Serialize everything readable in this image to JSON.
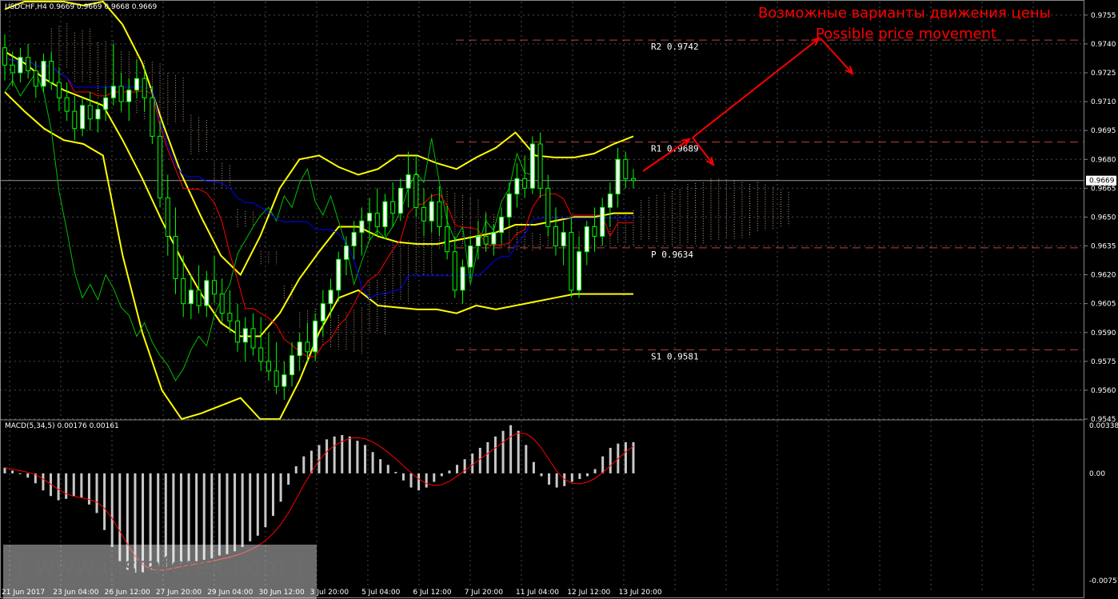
{
  "header": {
    "symbol_line": "USDCHF,H4  0.9669 0.9669 0.9668 0.9669",
    "annotation_ru": "Возможные варианты движения цены",
    "annotation_en": "Possible price movement"
  },
  "colors": {
    "background": "#000000",
    "grid": "#4a4a4a",
    "candle": "#ffffff",
    "candle_body": "#00ff00",
    "bollinger": "#ffff00",
    "kijun": "#0000ff",
    "tenkan": "#ff0000",
    "chikou": "#00c000",
    "cloud": "#c8a080",
    "pivot_lines": "#c04040",
    "arrows": "#ff0000",
    "macd_hist": "#c8c8c8",
    "macd_signal": "#ff0000",
    "watermark": "#6e6e6e"
  },
  "watermark": "[ www.instaforex.com ]",
  "chart_data": {
    "type": "candlestick",
    "ylim": [
      0.9545,
      0.9762
    ],
    "current_price": "0.9669",
    "price_ticks": [
      "0.9755",
      "0.9740",
      "0.9725",
      "0.9710",
      "0.9695",
      "0.9680",
      "0.9665",
      "0.9650",
      "0.9635",
      "0.9620",
      "0.9605",
      "0.9590",
      "0.9575",
      "0.9560",
      "0.9545"
    ],
    "date_labels": [
      "21 Jun 2017",
      "23 Jun 04:00",
      "26 Jun 12:00",
      "27 Jun 20:00",
      "29 Jun 04:00",
      "30 Jun 12:00",
      "3 Jul 20:00",
      "5 Jul 04:00",
      "6 Jul 12:00",
      "7 Jul 20:00",
      "11 Jul 04:00",
      "12 Jul 12:00",
      "13 Jul 20:00"
    ],
    "pivots": [
      {
        "label": "R2",
        "value": "0.9742"
      },
      {
        "label": "R1",
        "value": "0.9689"
      },
      {
        "label": "P",
        "value": "0.9634"
      },
      {
        "label": "S1",
        "value": "0.9581"
      }
    ],
    "candles": [
      [
        0.9738,
        0.9745,
        0.9721,
        0.9729
      ],
      [
        0.9729,
        0.9736,
        0.9718,
        0.9725
      ],
      [
        0.9725,
        0.9738,
        0.972,
        0.9733
      ],
      [
        0.9733,
        0.974,
        0.9722,
        0.9726
      ],
      [
        0.9726,
        0.9731,
        0.9712,
        0.9718
      ],
      [
        0.9718,
        0.9735,
        0.9715,
        0.9731
      ],
      [
        0.9731,
        0.9736,
        0.9716,
        0.972
      ],
      [
        0.972,
        0.9728,
        0.9705,
        0.9712
      ],
      [
        0.9712,
        0.972,
        0.97,
        0.9705
      ],
      [
        0.9705,
        0.9713,
        0.969,
        0.9696
      ],
      [
        0.9696,
        0.9712,
        0.9692,
        0.9708
      ],
      [
        0.9708,
        0.9715,
        0.9695,
        0.9701
      ],
      [
        0.9701,
        0.971,
        0.9694,
        0.9706
      ],
      [
        0.9706,
        0.9718,
        0.97,
        0.9712
      ],
      [
        0.9712,
        0.974,
        0.9708,
        0.9718
      ],
      [
        0.9718,
        0.9725,
        0.9705,
        0.971
      ],
      [
        0.971,
        0.9722,
        0.97,
        0.9716
      ],
      [
        0.9716,
        0.9732,
        0.9712,
        0.9722
      ],
      [
        0.9722,
        0.9728,
        0.9705,
        0.9712
      ],
      [
        0.9712,
        0.9718,
        0.9688,
        0.9692
      ],
      [
        0.9692,
        0.97,
        0.9655,
        0.966
      ],
      [
        0.966,
        0.9672,
        0.963,
        0.964
      ],
      [
        0.964,
        0.9655,
        0.961,
        0.9618
      ],
      [
        0.9618,
        0.963,
        0.9598,
        0.9605
      ],
      [
        0.9605,
        0.962,
        0.9597,
        0.9612
      ],
      [
        0.9612,
        0.9625,
        0.96,
        0.9604
      ],
      [
        0.9604,
        0.9622,
        0.9598,
        0.9617
      ],
      [
        0.9617,
        0.963,
        0.9605,
        0.961
      ],
      [
        0.961,
        0.9618,
        0.9595,
        0.96
      ],
      [
        0.96,
        0.9612,
        0.959,
        0.9596
      ],
      [
        0.9596,
        0.9605,
        0.958,
        0.9585
      ],
      [
        0.9585,
        0.9598,
        0.9575,
        0.9592
      ],
      [
        0.9592,
        0.96,
        0.9578,
        0.9582
      ],
      [
        0.9582,
        0.9598,
        0.957,
        0.9575
      ],
      [
        0.9575,
        0.959,
        0.9565,
        0.957
      ],
      [
        0.957,
        0.9585,
        0.9558,
        0.9562
      ],
      [
        0.9562,
        0.9575,
        0.9555,
        0.9568
      ],
      [
        0.9568,
        0.9585,
        0.9562,
        0.9578
      ],
      [
        0.9578,
        0.959,
        0.957,
        0.9585
      ],
      [
        0.9585,
        0.9595,
        0.9575,
        0.958
      ],
      [
        0.958,
        0.96,
        0.9575,
        0.9596
      ],
      [
        0.9596,
        0.9612,
        0.9588,
        0.9605
      ],
      [
        0.9605,
        0.9618,
        0.9598,
        0.9612
      ],
      [
        0.9612,
        0.9632,
        0.9606,
        0.9628
      ],
      [
        0.9628,
        0.964,
        0.962,
        0.9635
      ],
      [
        0.9635,
        0.9648,
        0.9628,
        0.9642
      ],
      [
        0.9642,
        0.9655,
        0.963,
        0.9648
      ],
      [
        0.9648,
        0.966,
        0.9638,
        0.9652
      ],
      [
        0.9652,
        0.9665,
        0.964,
        0.9645
      ],
      [
        0.9645,
        0.9662,
        0.964,
        0.9658
      ],
      [
        0.9658,
        0.9668,
        0.9645,
        0.9652
      ],
      [
        0.9652,
        0.967,
        0.9648,
        0.9665
      ],
      [
        0.9665,
        0.9684,
        0.9655,
        0.9672
      ],
      [
        0.9672,
        0.9682,
        0.965,
        0.9655
      ],
      [
        0.9655,
        0.9665,
        0.964,
        0.9648
      ],
      [
        0.9648,
        0.9662,
        0.9642,
        0.9658
      ],
      [
        0.9658,
        0.9666,
        0.964,
        0.9645
      ],
      [
        0.9645,
        0.9656,
        0.9628,
        0.9632
      ],
      [
        0.9632,
        0.964,
        0.9608,
        0.9612
      ],
      [
        0.9612,
        0.9628,
        0.9605,
        0.9624
      ],
      [
        0.9624,
        0.964,
        0.9618,
        0.9635
      ],
      [
        0.9635,
        0.9648,
        0.9628,
        0.964
      ],
      [
        0.964,
        0.9652,
        0.9632,
        0.9636
      ],
      [
        0.9636,
        0.9646,
        0.963,
        0.9642
      ],
      [
        0.9642,
        0.9655,
        0.9636,
        0.965
      ],
      [
        0.965,
        0.9668,
        0.9645,
        0.9662
      ],
      [
        0.9662,
        0.9678,
        0.9655,
        0.967
      ],
      [
        0.967,
        0.9682,
        0.966,
        0.9665
      ],
      [
        0.9665,
        0.9692,
        0.9662,
        0.9688
      ],
      [
        0.9688,
        0.9694,
        0.966,
        0.9665
      ],
      [
        0.9665,
        0.9672,
        0.964,
        0.9645
      ],
      [
        0.9645,
        0.9655,
        0.963,
        0.9635
      ],
      [
        0.9635,
        0.9648,
        0.9625,
        0.9642
      ],
      [
        0.9642,
        0.965,
        0.9608,
        0.9612
      ],
      [
        0.9612,
        0.964,
        0.9608,
        0.9632
      ],
      [
        0.9632,
        0.9648,
        0.9625,
        0.9645
      ],
      [
        0.9645,
        0.9655,
        0.9632,
        0.964
      ],
      [
        0.964,
        0.966,
        0.9635,
        0.9655
      ],
      [
        0.9655,
        0.9668,
        0.9645,
        0.9662
      ],
      [
        0.9662,
        0.9686,
        0.9655,
        0.968
      ],
      [
        0.968,
        0.9684,
        0.9665,
        0.967
      ],
      [
        0.967,
        0.9675,
        0.9665,
        0.9669
      ]
    ],
    "bollinger_upper": [
      0.9758,
      0.9766,
      0.9772,
      0.977,
      0.976,
      0.9762,
      0.975,
      0.973,
      0.97,
      0.9672,
      0.965,
      0.963,
      0.962,
      0.964,
      0.9665,
      0.968,
      0.9682,
      0.9676,
      0.9672,
      0.9675,
      0.9682,
      0.9682,
      0.9678,
      0.9675,
      0.9681,
      0.9686,
      0.9694,
      0.9682,
      0.9681,
      0.9681,
      0.9683,
      0.9688,
      0.9692
    ],
    "bollinger_mid": [
      0.9736,
      0.973,
      0.9722,
      0.9716,
      0.9712,
      0.9708,
      0.969,
      0.967,
      0.9648,
      0.9628,
      0.961,
      0.9595,
      0.9588,
      0.9588,
      0.96,
      0.9618,
      0.9632,
      0.9645,
      0.9645,
      0.964,
      0.9637,
      0.9636,
      0.9636,
      0.9638,
      0.964,
      0.9642,
      0.9646,
      0.9646,
      0.9648,
      0.965,
      0.965,
      0.9652,
      0.9652
    ],
    "bollinger_lower": [
      0.9715,
      0.9705,
      0.9696,
      0.969,
      0.9688,
      0.9682,
      0.963,
      0.959,
      0.956,
      0.9545,
      0.9548,
      0.9552,
      0.9556,
      0.9544,
      0.9545,
      0.9565,
      0.959,
      0.9608,
      0.9612,
      0.9604,
      0.9603,
      0.9602,
      0.9602,
      0.96,
      0.9604,
      0.9602,
      0.9604,
      0.9606,
      0.9608,
      0.961,
      0.961,
      0.961,
      0.961
    ],
    "macd_signal_label": "MACD(5,34,5) 0.00176 0.00161",
    "macd_ticks": [
      "0.00338",
      "0.00",
      "-0.00757"
    ],
    "macd_hist": [
      0.0004,
      0.0002,
      0.0,
      -0.0003,
      -0.0007,
      -0.0012,
      -0.0016,
      -0.0019,
      -0.0018,
      -0.0016,
      -0.0017,
      -0.0022,
      -0.0028,
      -0.004,
      -0.0052,
      -0.0062,
      -0.0068,
      -0.007,
      -0.007,
      -0.0068,
      -0.0066,
      -0.0066,
      -0.0065,
      -0.0064,
      -0.0063,
      -0.0062,
      -0.0061,
      -0.006,
      -0.0058,
      -0.0057,
      -0.0055,
      -0.0052,
      -0.0048,
      -0.0044,
      -0.0038,
      -0.003,
      -0.002,
      -0.0008,
      0.0005,
      0.0012,
      0.0016,
      0.002,
      0.0024,
      0.0026,
      0.0027,
      0.0026,
      0.0023,
      0.002,
      0.0015,
      0.001,
      0.0006,
      0.0001,
      -0.0005,
      -0.001,
      -0.0012,
      -0.001,
      -0.0006,
      -0.0002,
      0.0002,
      0.0006,
      0.001,
      0.0014,
      0.0018,
      0.0022,
      0.0026,
      0.003,
      0.0034,
      0.003,
      0.002,
      0.0008,
      -0.0002,
      -0.0008,
      -0.001,
      -0.0009,
      -0.0006,
      -0.0004,
      -0.0002,
      0.0003,
      0.0012,
      0.0018,
      0.0021,
      0.0022,
      0.0022
    ]
  }
}
